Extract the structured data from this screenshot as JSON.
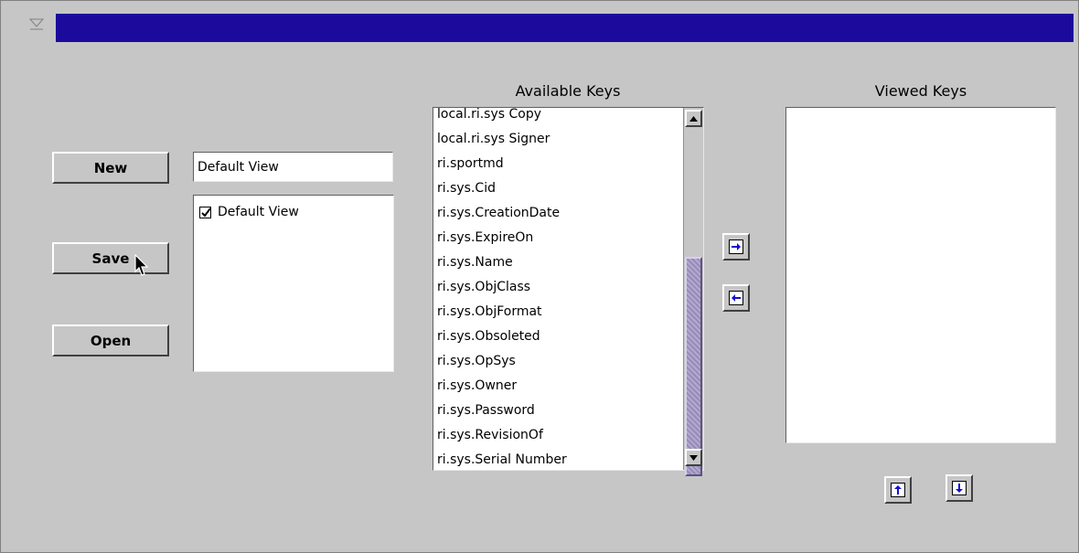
{
  "window": {
    "title": ""
  },
  "left": {
    "new_label": "New",
    "save_label": "Save",
    "open_label": "Open",
    "view_name_value": "Default View",
    "views": [
      {
        "label": "Default View",
        "checked": true
      }
    ]
  },
  "available": {
    "heading": "Available Keys",
    "items": [
      "local.ri.sys Copy",
      "local.ri.sys Signer",
      "ri.sportmd",
      "ri.sys.Cid",
      "ri.sys.CreationDate",
      "ri.sys.ExpireOn",
      "ri.sys.Name",
      "ri.sys.ObjClass",
      "ri.sys.ObjFormat",
      "ri.sys.Obsoleted",
      "ri.sys.OpSys",
      "ri.sys.Owner",
      "ri.sys.Password",
      "ri.sys.RevisionOf",
      "ri.sys.Serial Number"
    ]
  },
  "viewed": {
    "heading": "Viewed Keys",
    "items": []
  },
  "icons": {
    "system_menu": "window-menu-icon",
    "add": "arrow-right-icon",
    "remove": "arrow-left-icon",
    "move_up": "arrow-up-icon",
    "move_down": "arrow-down-icon",
    "scroll_up": "scroll-up-arrow-icon",
    "scroll_down": "scroll-down-arrow-icon",
    "pointer": "mouse-pointer-icon"
  },
  "colors": {
    "title_bar": "#1c0a9c",
    "background": "#c6c6c6",
    "arrow_accent": "#1010d0",
    "scroll_thumb": "#a599c3"
  },
  "scroll": {
    "thumb_fraction_visible": 0.62
  }
}
